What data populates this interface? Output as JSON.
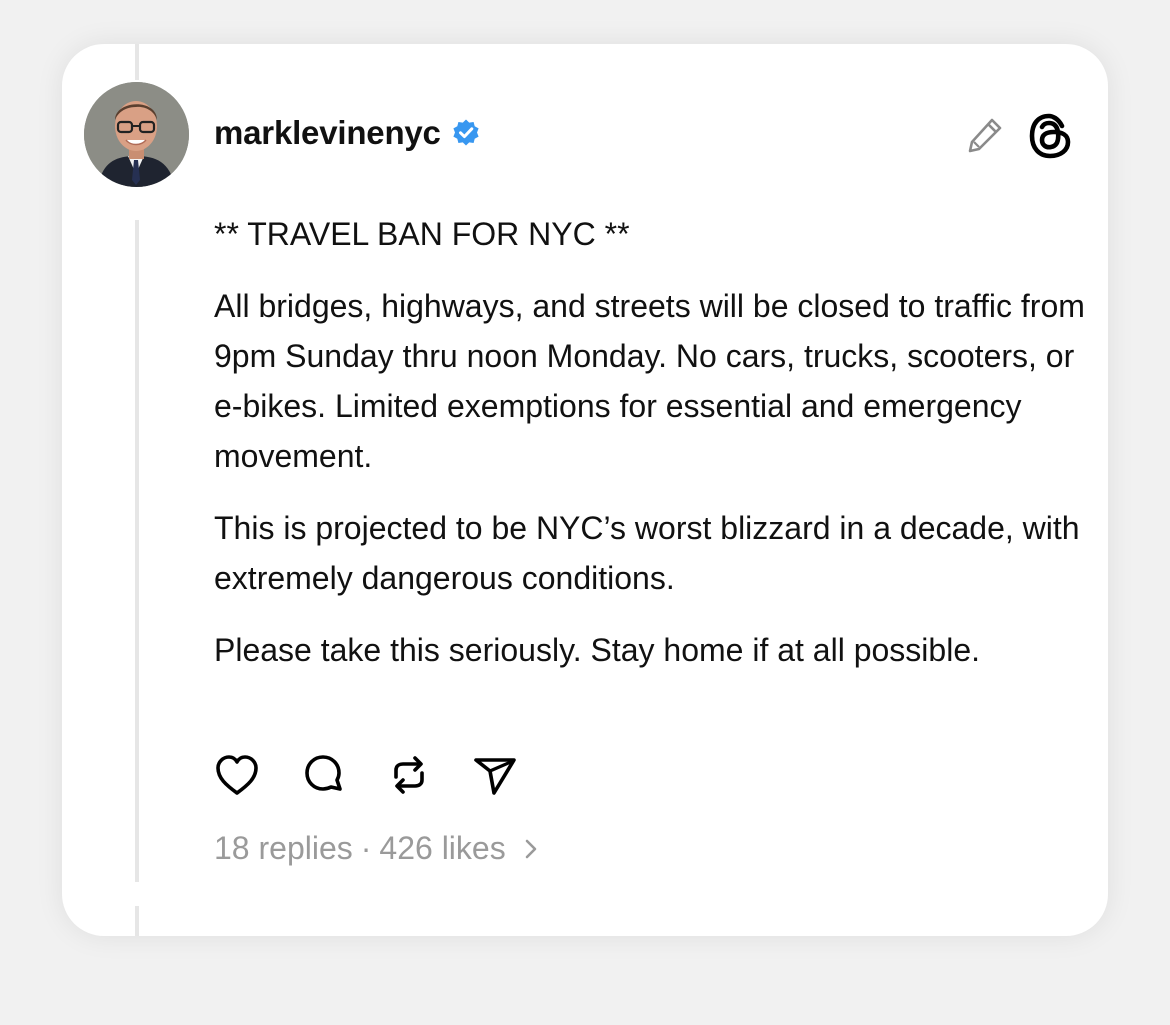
{
  "post": {
    "username": "marklevinenyc",
    "verified": true,
    "paragraphs": [
      "** TRAVEL BAN FOR NYC **",
      "All bridges, highways, and streets will be closed to traffic from 9pm Sunday thru noon Monday. No cars, trucks, scooters, or e-bikes. Limited exemptions for essential and emergency movement.",
      "This is projected to be NYC’s worst blizzard in a decade, with extremely dangerous conditions.",
      "Please take this seriously. Stay home if at all possible."
    ],
    "replies_text": "18 replies",
    "separator": "·",
    "likes_text": "426 likes"
  },
  "icons": {
    "header": [
      "verified-badge-icon",
      "pencil-icon",
      "threads-logo-icon"
    ],
    "actions": [
      "heart-icon",
      "comment-icon",
      "repost-icon",
      "share-icon"
    ],
    "footer": [
      "chevron-right-icon"
    ]
  },
  "colors": {
    "verified_blue": "#3897f0",
    "text": "#111111",
    "muted": "#9a9a9a",
    "thread_line": "#e6e6e6",
    "page_background": "#f1f1f1",
    "card_background": "#ffffff"
  }
}
